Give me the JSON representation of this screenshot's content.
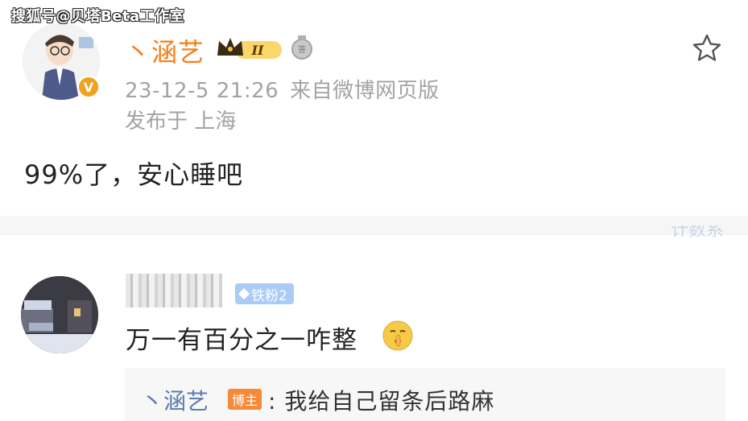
{
  "watermark": "搜狐号@贝塔Beta工作室",
  "post": {
    "username": "丶涵艺",
    "level_badge": "II",
    "timestamp": "23-12-5 21:26",
    "source": "来自微博网页版",
    "location": "发布于 上海",
    "content": "99%了，安心睡吧",
    "vip_mark": "V"
  },
  "separator_ghost_text": "计数系",
  "comment": {
    "fan_badge": "铁粉2",
    "text": "万一有百分之一咋整",
    "emoji": "shush-emoji",
    "reply": {
      "author": "丶涵艺",
      "author_badge": "博主",
      "text": ": 我给自己留条后路麻"
    }
  },
  "colors": {
    "username": "#f57f17",
    "meta": "#a3a3a3",
    "reply_link": "#5b7bb0",
    "fan_badge": "#a9cbf5",
    "host_badge": "#f58a3a"
  }
}
